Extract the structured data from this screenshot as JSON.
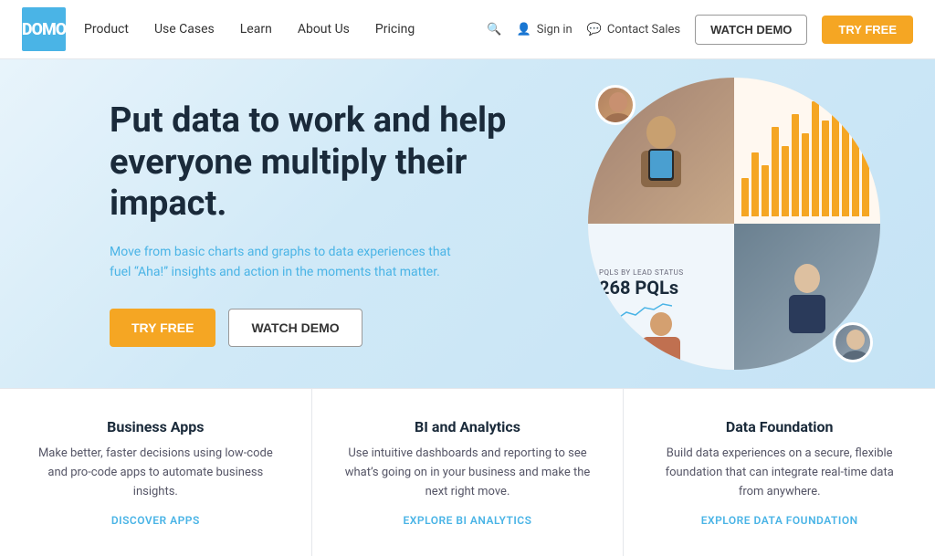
{
  "nav": {
    "logo_text": "DOMO",
    "links": [
      {
        "label": "Product",
        "id": "product"
      },
      {
        "label": "Use Cases",
        "id": "use-cases"
      },
      {
        "label": "Learn",
        "id": "learn"
      },
      {
        "label": "About Us",
        "id": "about"
      },
      {
        "label": "Pricing",
        "id": "pricing"
      }
    ],
    "search_label": "Search",
    "signin_label": "Sign in",
    "contact_label": "Contact Sales",
    "watch_demo_label": "WATCH DEMO",
    "try_free_label": "TRY FREE"
  },
  "hero": {
    "heading": "Put data to work and help everyone multiply their impact.",
    "subtext_part1": "Move from basic charts and graphs to data experiences that fuel “Aha!” insights and action in ",
    "subtext_highlight": "the moments that matter.",
    "try_free_label": "TRY FREE",
    "watch_demo_label": "WATCH DEMO"
  },
  "hero_visual": {
    "stats_label": "PQLs BY LEAD STATUS",
    "stats_value": "268 PQLs",
    "bars": [
      30,
      50,
      40,
      70,
      55,
      80,
      65,
      90,
      75,
      95,
      85,
      100,
      88
    ]
  },
  "cards": [
    {
      "title": "Business Apps",
      "desc": "Make better, faster decisions using low-code and pro-code apps to automate business insights.",
      "link": "DISCOVER APPS"
    },
    {
      "title": "BI and Analytics",
      "desc": "Use intuitive dashboards and reporting to see what’s going on in your business and make the next right move.",
      "link": "EXPLORE BI ANALYTICS"
    },
    {
      "title": "Data Foundation",
      "desc": "Build data experiences on a secure, flexible foundation that can integrate real-time data from anywhere.",
      "link": "EXPLORE DATA FOUNDATION"
    }
  ]
}
